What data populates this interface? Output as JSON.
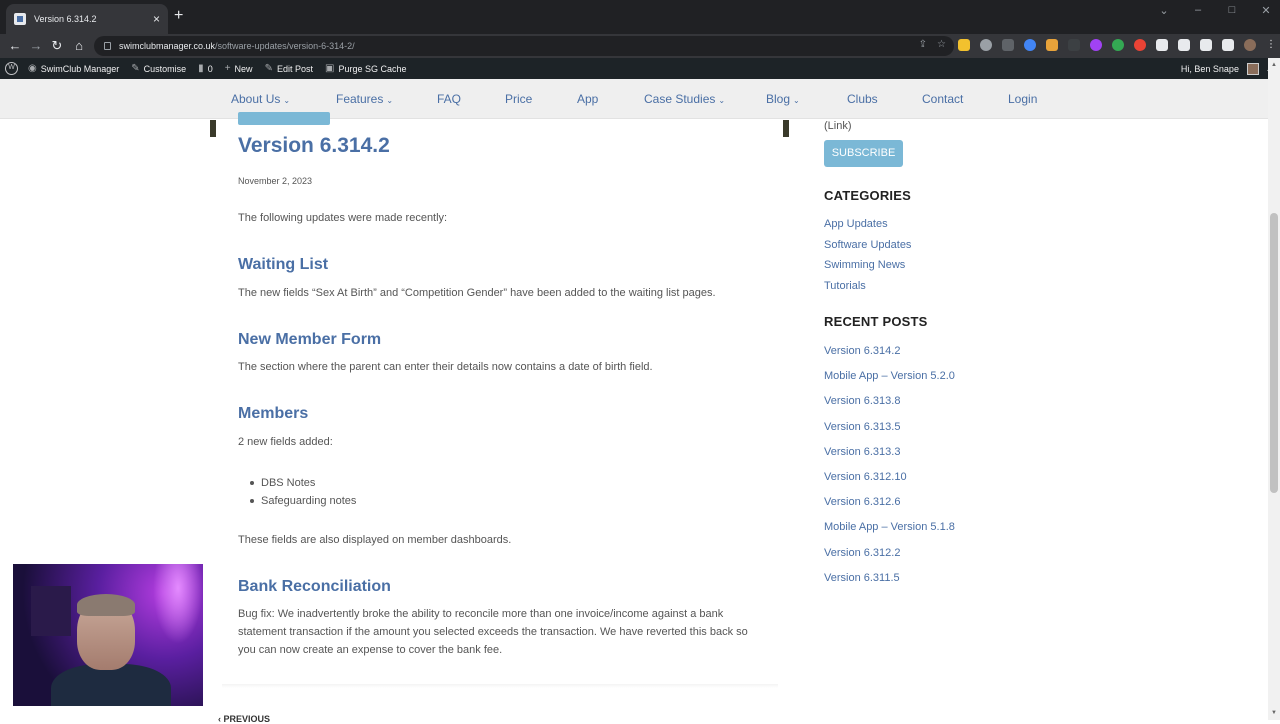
{
  "browser": {
    "tab_title": "Version 6.314.2",
    "url_host": "swimclubmanager.co.uk",
    "url_path": "/software-updates/version-6-314-2/"
  },
  "wp_admin_bar": {
    "site_name": "SwimClub Manager",
    "customise": "Customise",
    "comments_count": "0",
    "new": "New",
    "edit_post": "Edit Post",
    "purge_cache": "Purge SG Cache",
    "greeting": "Hi, Ben Snape"
  },
  "nav": {
    "items": [
      {
        "label": "About Us",
        "dropdown": true
      },
      {
        "label": "Features",
        "dropdown": true
      },
      {
        "label": "FAQ",
        "dropdown": false
      },
      {
        "label": "Price",
        "dropdown": false
      },
      {
        "label": "App",
        "dropdown": false
      },
      {
        "label": "Case Studies",
        "dropdown": true
      },
      {
        "label": "Blog",
        "dropdown": true
      },
      {
        "label": "Clubs",
        "dropdown": false
      },
      {
        "label": "Contact",
        "dropdown": false
      },
      {
        "label": "Login",
        "dropdown": false
      }
    ],
    "caret": "⌄"
  },
  "post": {
    "title": "Version 6.314.2",
    "date": "November 2, 2023",
    "intro": "The following updates were made recently:",
    "sections": [
      {
        "heading": "Waiting List",
        "body": "The new fields “Sex At Birth” and “Competition Gender” have been added to the waiting list pages."
      },
      {
        "heading": "New Member Form",
        "body": "The section where the parent can enter their details now contains a date of birth field."
      },
      {
        "heading": "Members",
        "body": "2 new fields added:"
      },
      {
        "heading": "Bank Reconciliation",
        "body": "Bug fix: We inadvertently broke the ability to reconcile more than one invoice/income against a bank statement transaction if the amount you selected exceeds the transaction. We have reverted this back so you can now create an expense to cover the bank fee."
      }
    ],
    "member_bullets": [
      "DBS Notes",
      "Safeguarding notes"
    ],
    "members_footer": "These fields are also displayed on member dashboards.",
    "previous_label": "PREVIOUS"
  },
  "sidebar": {
    "link_text": "(Link)",
    "subscribe_label": "SUBSCRIBE",
    "categories_heading": "CATEGORIES",
    "categories": [
      "App Updates",
      "Software Updates",
      "Swimming News",
      "Tutorials"
    ],
    "recent_heading": "RECENT POSTS",
    "recent_posts": [
      "Version 6.314.2",
      "Mobile App – Version 5.2.0",
      "Version 6.313.8",
      "Version 6.313.5",
      "Version 6.313.3",
      "Version 6.312.10",
      "Version 6.312.6",
      "Mobile App – Version 5.1.8",
      "Version 6.312.2",
      "Version 6.311.5"
    ]
  },
  "colors": {
    "accent": "#4a6fa5",
    "button": "#7bb8d6",
    "admin_bar": "#1d2327"
  }
}
